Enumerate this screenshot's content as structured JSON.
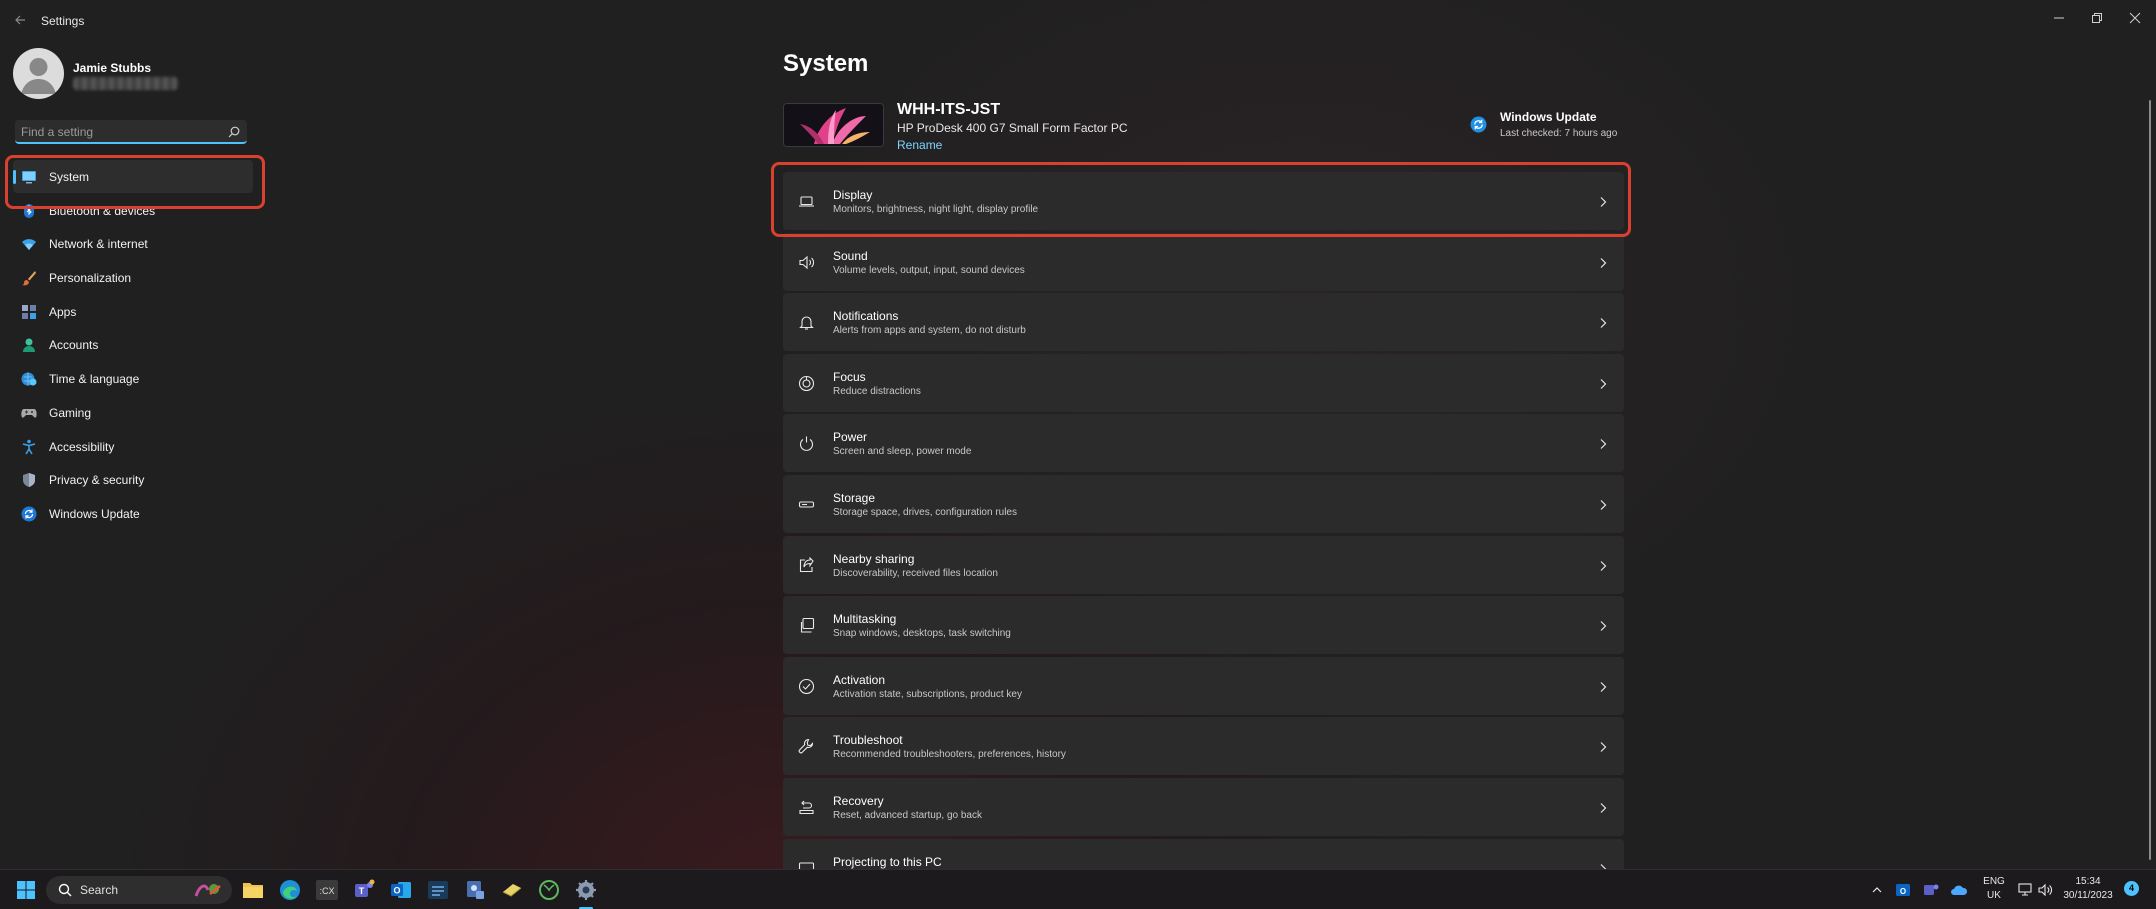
{
  "window": {
    "title": "Settings"
  },
  "profile": {
    "name": "Jamie Stubbs"
  },
  "search": {
    "placeholder": "Find a setting"
  },
  "sidebar": {
    "items": [
      {
        "label": "System",
        "icon": "display-icon",
        "selected": true
      },
      {
        "label": "Bluetooth & devices",
        "icon": "bluetooth-icon"
      },
      {
        "label": "Network & internet",
        "icon": "wifi-icon"
      },
      {
        "label": "Personalization",
        "icon": "paintbrush-icon"
      },
      {
        "label": "Apps",
        "icon": "apps-icon"
      },
      {
        "label": "Accounts",
        "icon": "person-icon"
      },
      {
        "label": "Time & language",
        "icon": "globe-clock-icon"
      },
      {
        "label": "Gaming",
        "icon": "gamepad-icon"
      },
      {
        "label": "Accessibility",
        "icon": "accessibility-icon"
      },
      {
        "label": "Privacy & security",
        "icon": "shield-icon"
      },
      {
        "label": "Windows Update",
        "icon": "update-icon"
      }
    ]
  },
  "main": {
    "title": "System",
    "device": {
      "name": "WHH-ITS-JST",
      "model": "HP ProDesk 400 G7 Small Form Factor PC",
      "rename_label": "Rename"
    },
    "windows_update": {
      "title": "Windows Update",
      "status": "Last checked: 7 hours ago"
    },
    "cards": [
      {
        "title": "Display",
        "desc": "Monitors, brightness, night light, display profile",
        "icon": "laptop-icon"
      },
      {
        "title": "Sound",
        "desc": "Volume levels, output, input, sound devices",
        "icon": "speaker-icon"
      },
      {
        "title": "Notifications",
        "desc": "Alerts from apps and system, do not disturb",
        "icon": "bell-icon"
      },
      {
        "title": "Focus",
        "desc": "Reduce distractions",
        "icon": "focus-icon"
      },
      {
        "title": "Power",
        "desc": "Screen and sleep, power mode",
        "icon": "power-icon"
      },
      {
        "title": "Storage",
        "desc": "Storage space, drives, configuration rules",
        "icon": "drive-icon"
      },
      {
        "title": "Nearby sharing",
        "desc": "Discoverability, received files location",
        "icon": "share-icon"
      },
      {
        "title": "Multitasking",
        "desc": "Snap windows, desktops, task switching",
        "icon": "multitask-icon"
      },
      {
        "title": "Activation",
        "desc": "Activation state, subscriptions, product key",
        "icon": "check-circle-icon"
      },
      {
        "title": "Troubleshoot",
        "desc": "Recommended troubleshooters, preferences, history",
        "icon": "wrench-icon"
      },
      {
        "title": "Recovery",
        "desc": "Reset, advanced startup, go back",
        "icon": "recovery-icon"
      },
      {
        "title": "Projecting to this PC",
        "desc": "",
        "icon": "project-icon"
      }
    ]
  },
  "taskbar": {
    "search_label": "Search",
    "language": "ENG",
    "region": "UK",
    "time": "15:34",
    "date": "30/11/2023",
    "notification_count": "4"
  },
  "colors": {
    "accent": "#4cc2ff",
    "highlight_border": "#d8412f",
    "background": "#202020",
    "card": "#2b2b2b"
  }
}
